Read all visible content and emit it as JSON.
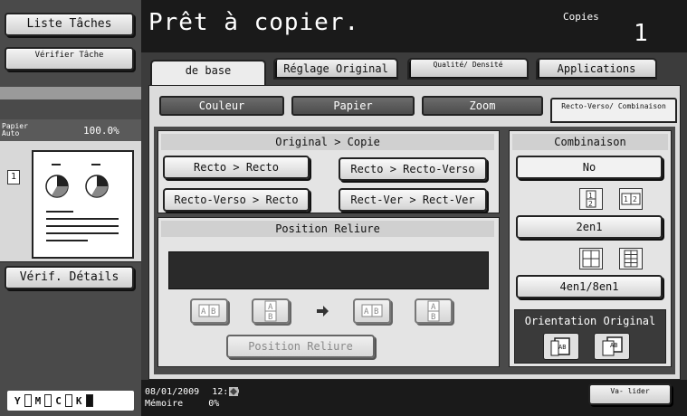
{
  "app": {
    "status_title": "Prêt à copier.",
    "copies_label": "Copies",
    "copies_value": "1"
  },
  "sidebar": {
    "job_list_label": "Liste Tâches",
    "check_job_label": "Vérifier Tâche",
    "preview": {
      "paper_label": "Papier Auto",
      "zoom": "100.0%",
      "page_number": "1"
    },
    "check_details_label": "Vérif. Détails",
    "toner": [
      "Y",
      "M",
      "C",
      "K"
    ]
  },
  "tabs": [
    {
      "label": "de base",
      "active": true
    },
    {
      "label": "Réglage Original",
      "active": false
    },
    {
      "label": "Qualité/ Densité",
      "active": false
    },
    {
      "label": "Applications",
      "active": false
    }
  ],
  "subtabs": [
    {
      "label": "Couleur"
    },
    {
      "label": "Papier"
    },
    {
      "label": "Zoom"
    },
    {
      "label": "Recto-Verso/ Combinaison",
      "active": true
    }
  ],
  "duplex": {
    "header": "Original > Copie",
    "options": [
      {
        "label": "Recto > Recto"
      },
      {
        "label": "Recto > Recto-Verso"
      },
      {
        "label": "Recto-Verso > Recto"
      },
      {
        "label": "Rect-Ver > Rect-Ver"
      }
    ],
    "binding_header": "Position Reliure",
    "binding_button": "Position Reliure"
  },
  "combine": {
    "header": "Combinaison",
    "no_label": "No",
    "two_in_one": "2en1",
    "four_eight": "4en1/8en1",
    "orientation_label": "Orientation Original"
  },
  "status": {
    "date": "08/01/2009",
    "time": "12:20",
    "memory_label": "Mémoire",
    "memory_value": "0%",
    "validate_label": "Va- lider"
  },
  "colors": {
    "bg_dark": "#1a1a1a",
    "panel": "#e4e4e4",
    "accent_dark": "#4c4c4c"
  }
}
